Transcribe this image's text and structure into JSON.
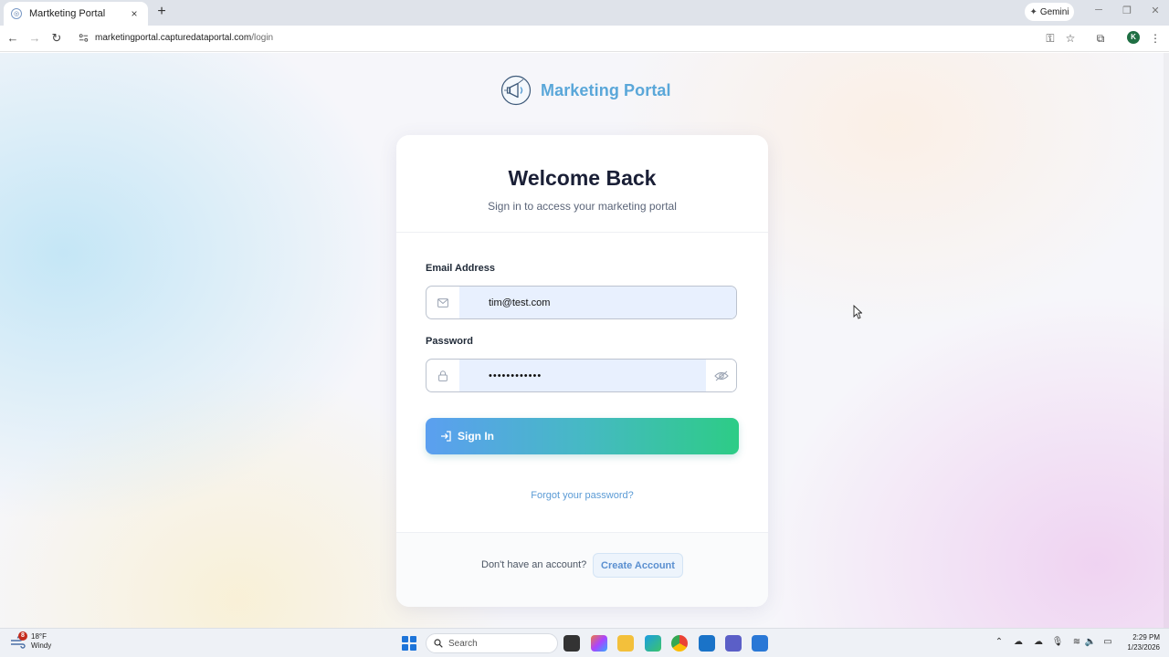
{
  "browser": {
    "tab_title": "Martketing Portal",
    "tab_close": "×",
    "new_tab": "+",
    "url_host": "marketingportal.capturedataportal.com",
    "url_path": "/login",
    "gemini_label": "Gemini",
    "profile_initial": "K"
  },
  "brand": {
    "name": "Marketing Portal"
  },
  "login": {
    "title": "Welcome Back",
    "subtitle": "Sign in to access your marketing portal",
    "email_label": "Email Address",
    "email_value": "tim@test.com",
    "password_label": "Password",
    "password_value": "••••••••••••",
    "signin_label": "Sign In",
    "forgot_label": "Forgot your password?",
    "no_account_text": "Don't have an account?",
    "create_account_label": "Create Account"
  },
  "taskbar": {
    "weather_badge": "8",
    "weather_temp": "18°F",
    "weather_desc": "Windy",
    "search_placeholder": "Search",
    "time": "2:29 PM",
    "date": "1/23/2026"
  },
  "colors": {
    "brand_blue": "#5aa7d9",
    "gradient_start": "#5b9ff0",
    "gradient_end": "#2dcc86",
    "input_fill": "#e8f0fe",
    "link_blue": "#5b9bd5"
  }
}
